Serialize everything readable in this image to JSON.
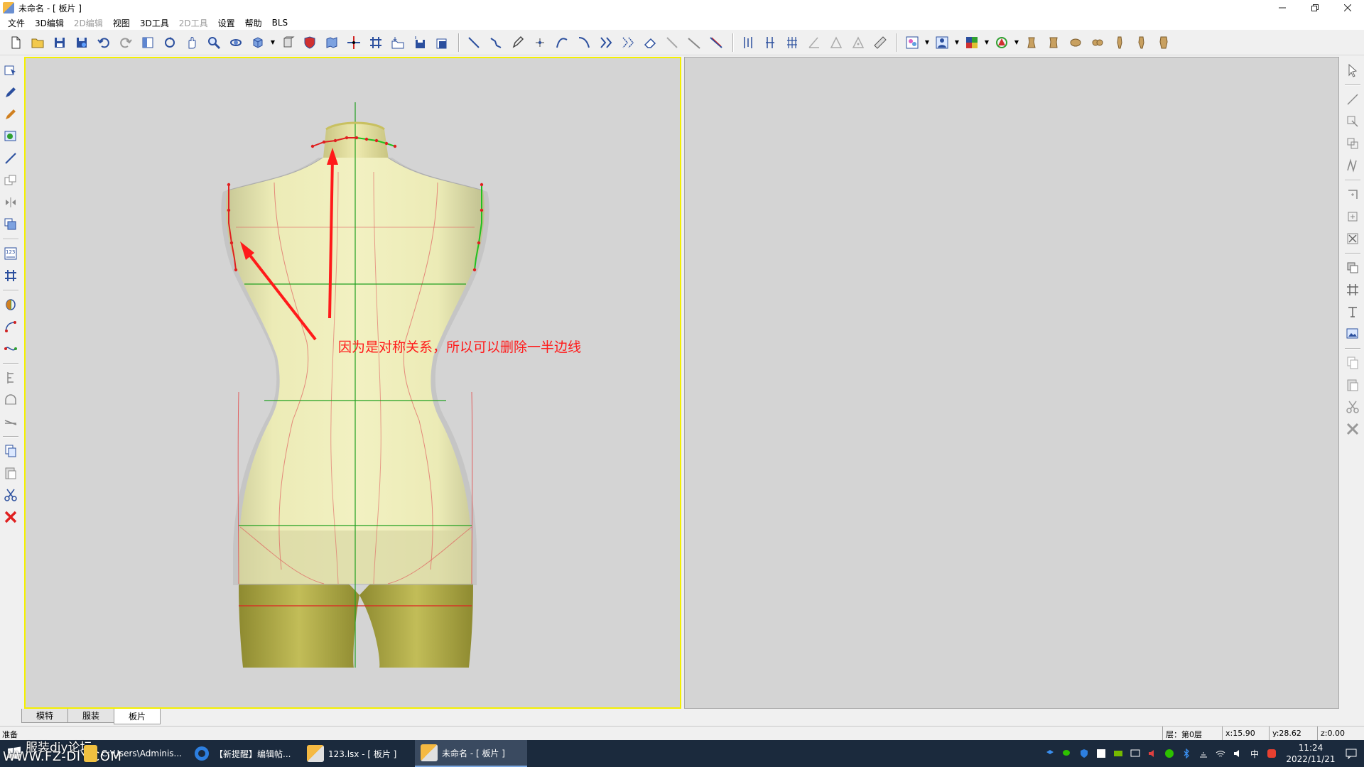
{
  "window": {
    "title": "未命名 - [ 板片 ]"
  },
  "menu": [
    {
      "label": "文件",
      "disabled": false
    },
    {
      "label": "3D编辑",
      "disabled": false
    },
    {
      "label": "2D编辑",
      "disabled": true
    },
    {
      "label": "视图",
      "disabled": false
    },
    {
      "label": "3D工具",
      "disabled": false
    },
    {
      "label": "2D工具",
      "disabled": true
    },
    {
      "label": "设置",
      "disabled": false
    },
    {
      "label": "帮助",
      "disabled": false
    },
    {
      "label": "BLS",
      "disabled": false
    }
  ],
  "viewport3d": {
    "annotation": "因为是对称关系，所以可以删除一半边线"
  },
  "tabs": [
    {
      "label": "模特",
      "active": false
    },
    {
      "label": "服装",
      "active": false
    },
    {
      "label": "板片",
      "active": true
    }
  ],
  "status": {
    "ready": "准备",
    "layer": "层：第0层",
    "x": "x:15.90",
    "y": "y:28.62",
    "z": "z:0.00"
  },
  "taskbar": {
    "watermark_line1": "服装diy论坛",
    "watermark_line2": "WWW.FZ-DIY.COM",
    "items": [
      {
        "label": "C:\\Users\\Adminis...",
        "icon_color": "#f0c040"
      },
      {
        "label": "【新提醒】编辑帖...",
        "icon_color": "#2d7fe0"
      },
      {
        "label": "123.lsx - [ 板片 ]",
        "icon_color": "#f5b942"
      },
      {
        "label": "未命名 - [ 板片 ]",
        "icon_color": "#f5b942"
      }
    ],
    "ime": "中",
    "time": "11:24",
    "date": "2022/11/21"
  },
  "colors": {
    "annotation": "#ff1a1a",
    "viewport_border": "#f4f000",
    "body_fill": "#eeeeb8",
    "leg_fill": "#b2ad48"
  }
}
